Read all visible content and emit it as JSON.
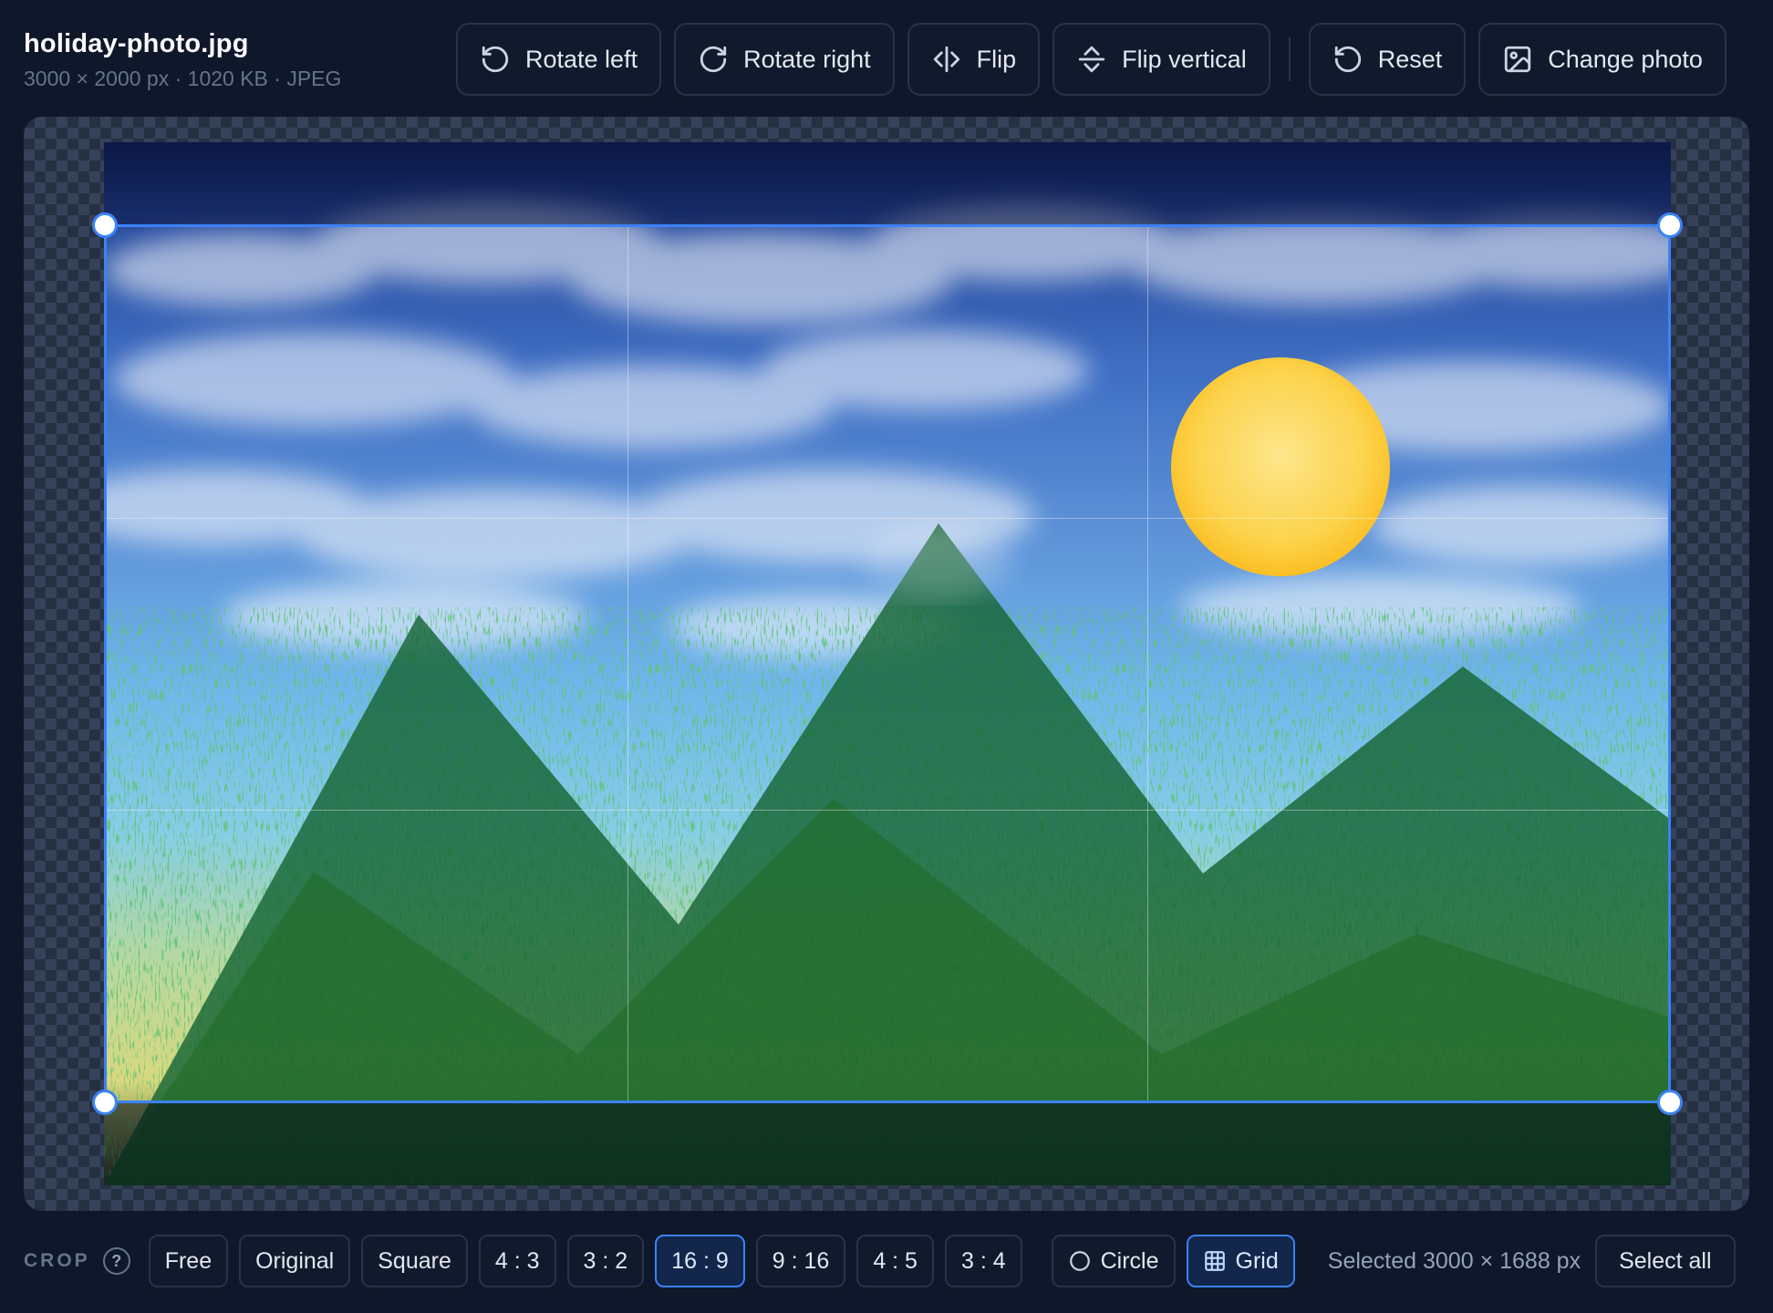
{
  "file": {
    "name": "holiday-photo.jpg",
    "meta": "3000 × 2000 px · 1020 KB · JPEG"
  },
  "toolbar": {
    "rotate_left": "Rotate left",
    "rotate_right": "Rotate right",
    "flip": "Flip",
    "flip_vertical": "Flip vertical",
    "reset": "Reset",
    "change_photo": "Change photo"
  },
  "crop": {
    "label": "CROP",
    "help": "?",
    "ratios": [
      "Free",
      "Original",
      "Square",
      "4 : 3",
      "3 : 2",
      "16 : 9",
      "9 : 16",
      "4 : 5",
      "3 : 4"
    ],
    "active_ratio": "16 : 9",
    "circle": "Circle",
    "grid": "Grid",
    "grid_enabled": true,
    "selected": "Selected 3000 × 1688 px",
    "select_all": "Select all"
  },
  "colors": {
    "accent": "#3b82f6",
    "background": "#0f172a",
    "sun": "#fcd34d",
    "mountain": "#166534"
  },
  "icons": [
    "rotate-left-icon",
    "rotate-right-icon",
    "flip-icon",
    "flip-vertical-icon",
    "reset-icon",
    "image-icon",
    "circle-icon",
    "grid-icon",
    "help-icon"
  ]
}
